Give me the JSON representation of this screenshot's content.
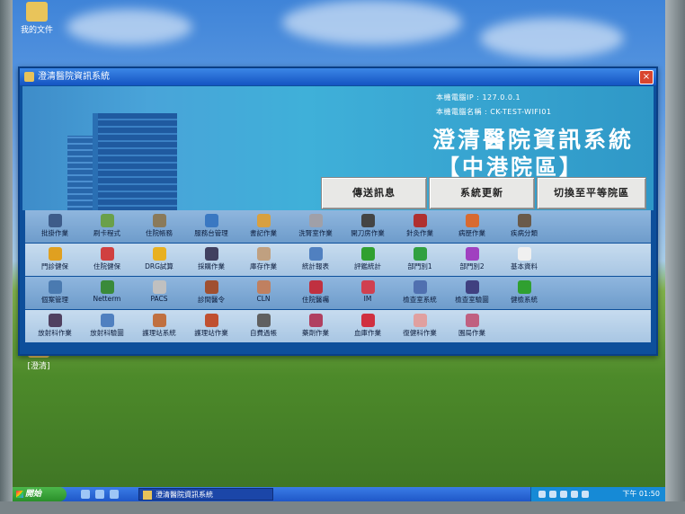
{
  "desktop": {
    "icons": [
      {
        "label": "我的文件"
      },
      {
        "label": "[澄清]"
      }
    ]
  },
  "window": {
    "title": "澄清醫院資訊系統",
    "close_label": "×"
  },
  "header": {
    "ip_line": "本機電腦IP  : 127.0.0.1",
    "name_line": "本機電腦名稱 : CK-TEST-WIFI01",
    "system_title": "澄清醫院資訊系統",
    "branch": "【中港院區】"
  },
  "top_buttons": {
    "send_message": "傳送訊息",
    "system_update": "系統更新",
    "switch_branch": "切換至平等院區"
  },
  "toolbar_rows": [
    [
      {
        "label": "批掛作業",
        "color": "#3e5c8a"
      },
      {
        "label": "刷卡程式",
        "color": "#6aa04a"
      },
      {
        "label": "住院帳務",
        "color": "#8a7a5a"
      },
      {
        "label": "服務台管理",
        "color": "#3a78c2"
      },
      {
        "label": "書記作業",
        "color": "#d8a040"
      },
      {
        "label": "洗腎室作業",
        "color": "#a0a0a8"
      },
      {
        "label": "開刀房作業",
        "color": "#444444"
      },
      {
        "label": "針灸作業",
        "color": "#b03030"
      },
      {
        "label": "病歷作業",
        "color": "#d86a30"
      },
      {
        "label": "疾病分類",
        "color": "#6a5a4a"
      }
    ],
    [
      {
        "label": "門診健保",
        "color": "#e0a020"
      },
      {
        "label": "住院健保",
        "color": "#d04040"
      },
      {
        "label": "DRG試算",
        "color": "#e8b020"
      },
      {
        "label": "採購作業",
        "color": "#404060"
      },
      {
        "label": "庫存作業",
        "color": "#c0a080"
      },
      {
        "label": "統計報表",
        "color": "#5080c0"
      },
      {
        "label": "評鑑統計",
        "color": "#30a030"
      },
      {
        "label": "部門別1",
        "color": "#30a040"
      },
      {
        "label": "部門別2",
        "color": "#a040c0"
      },
      {
        "label": "基本資料",
        "color": "#f0f0f0"
      }
    ],
    [
      {
        "label": "個案管理",
        "color": "#4a7ab0"
      },
      {
        "label": "Netterm",
        "color": "#3a8a3a"
      },
      {
        "label": "PACS",
        "color": "#c0c0c0"
      },
      {
        "label": "診間醫令",
        "color": "#a05030"
      },
      {
        "label": "CLN",
        "color": "#c08060"
      },
      {
        "label": "住院醫囑",
        "color": "#c03040"
      },
      {
        "label": "IM",
        "color": "#d04050"
      },
      {
        "label": "檢查室系統",
        "color": "#5070b0"
      },
      {
        "label": "檢查室驗圖",
        "color": "#404080"
      },
      {
        "label": "健檢系統",
        "color": "#30a030"
      }
    ],
    [
      {
        "label": "放射科作業",
        "color": "#504060"
      },
      {
        "label": "放射科驗圖",
        "color": "#5080c0"
      },
      {
        "label": "護理站系統",
        "color": "#c07040"
      },
      {
        "label": "護理站作業",
        "color": "#c05030"
      },
      {
        "label": "自費過帳",
        "color": "#606060"
      },
      {
        "label": "藥劑作業",
        "color": "#b04060"
      },
      {
        "label": "血庫作業",
        "color": "#d03040"
      },
      {
        "label": "復健科作業",
        "color": "#e0a0a0"
      },
      {
        "label": "園局作業",
        "color": "#c06080"
      }
    ]
  ],
  "taskbar": {
    "start_label": "開始",
    "task_label": "澄清醫院資訊系統",
    "clock": "下午 01:50"
  }
}
